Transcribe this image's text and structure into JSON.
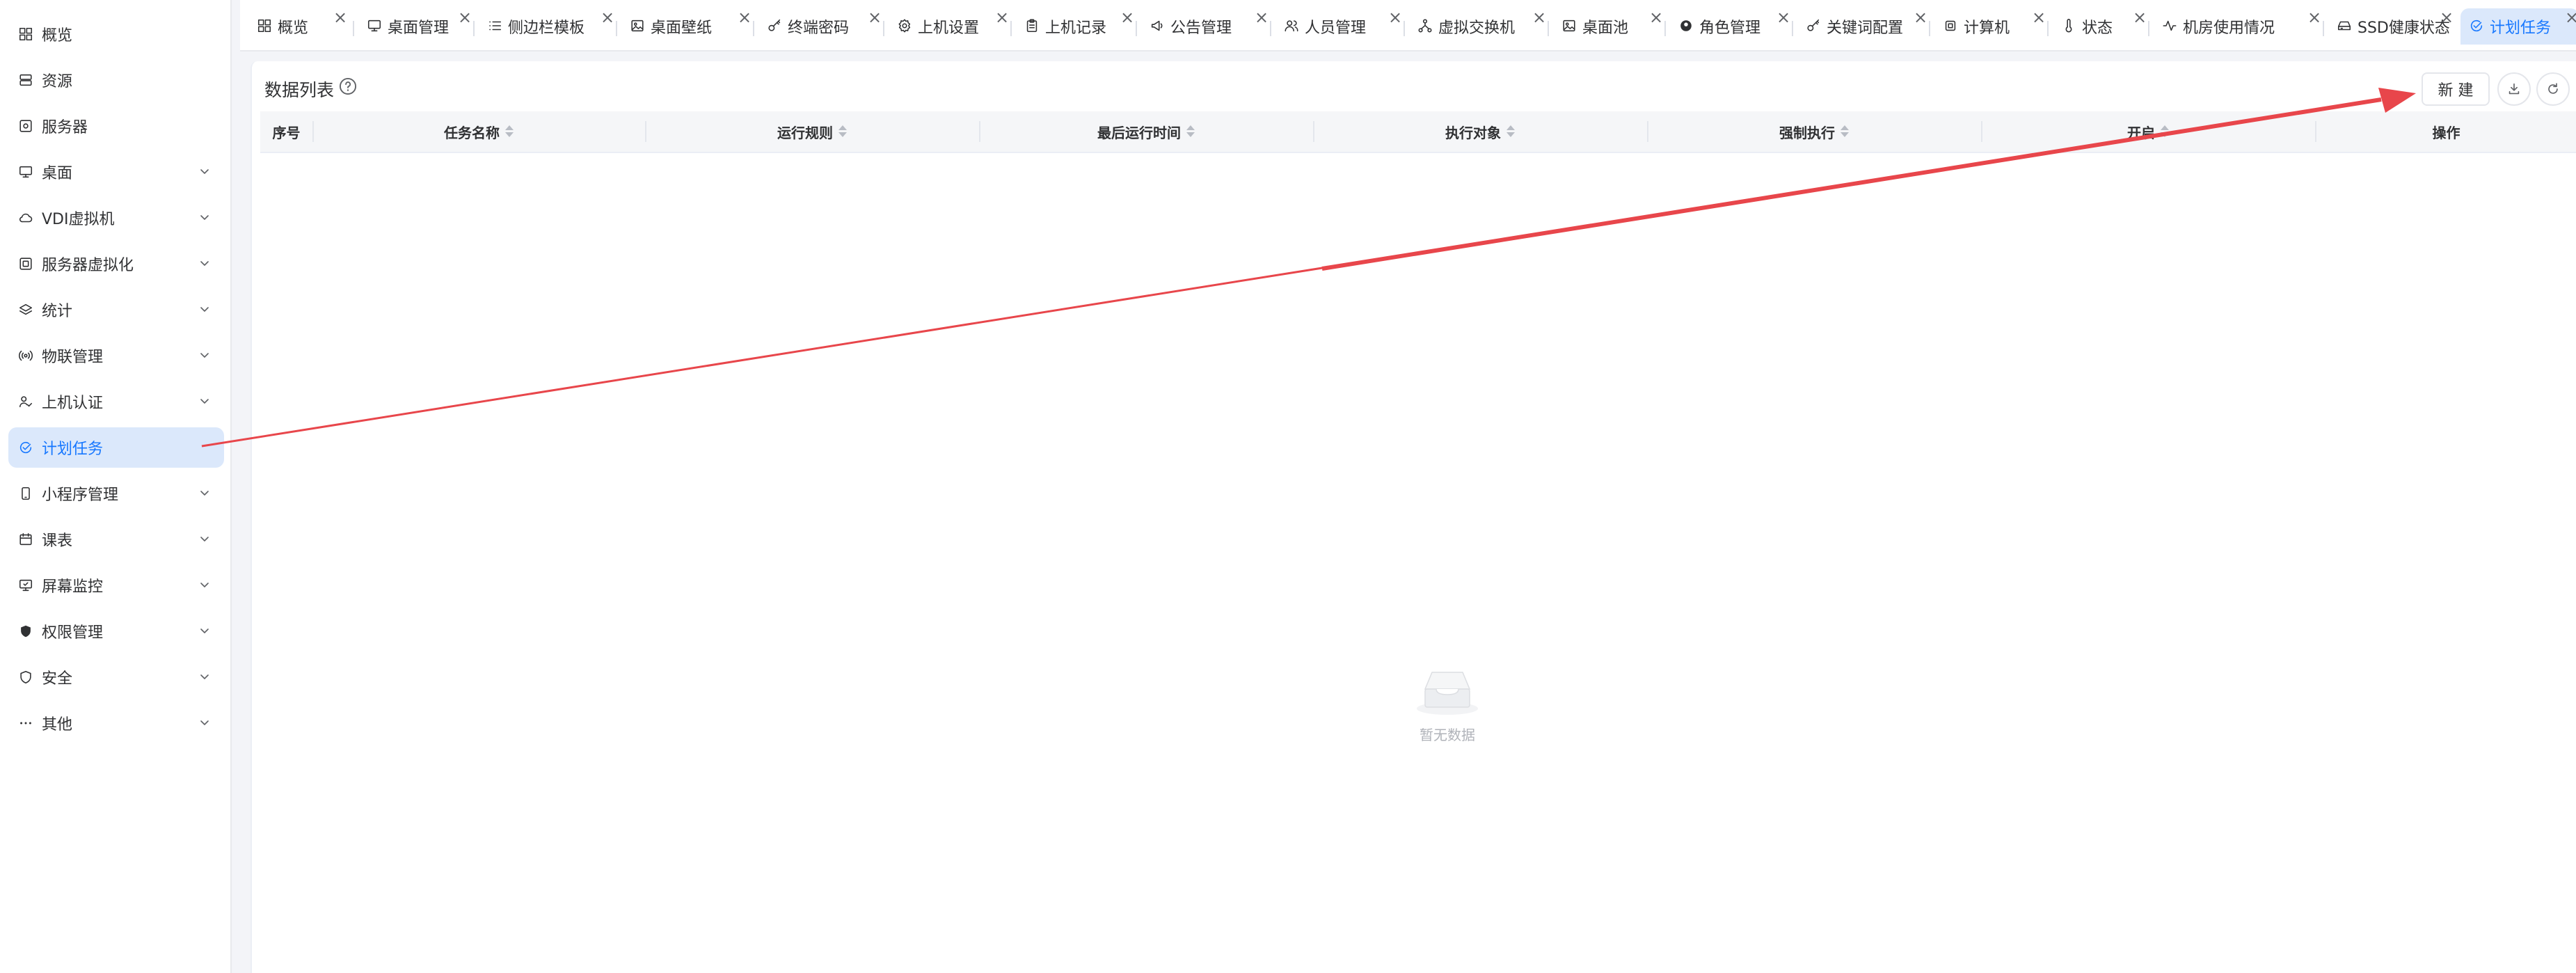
{
  "sidebar": {
    "items": [
      {
        "label": "概览",
        "icon": "grid-icon",
        "has_children": false
      },
      {
        "label": "资源",
        "icon": "server-stack-icon",
        "has_children": false
      },
      {
        "label": "服务器",
        "icon": "server-gear-icon",
        "has_children": false
      },
      {
        "label": "桌面",
        "icon": "monitor-icon",
        "has_children": true
      },
      {
        "label": "VDI虚拟机",
        "icon": "cloud-icon",
        "has_children": true
      },
      {
        "label": "服务器虚拟化",
        "icon": "server-virtual-icon",
        "has_children": true
      },
      {
        "label": "统计",
        "icon": "layers-icon",
        "has_children": true
      },
      {
        "label": "物联管理",
        "icon": "broadcast-icon",
        "has_children": true
      },
      {
        "label": "上机认证",
        "icon": "user-check-icon",
        "has_children": true
      },
      {
        "label": "计划任务",
        "icon": "clock-check-icon",
        "has_children": false,
        "active": true
      },
      {
        "label": "小程序管理",
        "icon": "phone-icon",
        "has_children": true
      },
      {
        "label": "课表",
        "icon": "calendar-icon",
        "has_children": true
      },
      {
        "label": "屏幕监控",
        "icon": "monitor-watch-icon",
        "has_children": true
      },
      {
        "label": "权限管理",
        "icon": "shield-lock-icon",
        "has_children": true
      },
      {
        "label": "安全",
        "icon": "shield-icon",
        "has_children": true
      },
      {
        "label": "其他",
        "icon": "more-icon",
        "has_children": true
      }
    ]
  },
  "tabs": [
    {
      "label": "概览",
      "icon": "grid-icon"
    },
    {
      "label": "桌面管理",
      "icon": "monitor-icon"
    },
    {
      "label": "侧边栏模板",
      "icon": "list-icon"
    },
    {
      "label": "桌面壁纸",
      "icon": "image-icon"
    },
    {
      "label": "终端密码",
      "icon": "key-icon"
    },
    {
      "label": "上机设置",
      "icon": "gear-icon"
    },
    {
      "label": "上机记录",
      "icon": "clipboard-icon"
    },
    {
      "label": "公告管理",
      "icon": "megaphone-icon"
    },
    {
      "label": "人员管理",
      "icon": "users-icon"
    },
    {
      "label": "虚拟交换机",
      "icon": "network-icon"
    },
    {
      "label": "桌面池",
      "icon": "image-icon"
    },
    {
      "label": "角色管理",
      "icon": "role-icon"
    },
    {
      "label": "关键词配置",
      "icon": "key-icon"
    },
    {
      "label": "计算机",
      "icon": "cpu-icon"
    },
    {
      "label": "状态",
      "icon": "thermometer-icon"
    },
    {
      "label": "机房使用情况",
      "icon": "activity-icon"
    },
    {
      "label": "SSD健康状态",
      "icon": "drive-icon"
    },
    {
      "label": "计划任务",
      "icon": "clock-check-icon",
      "active": true
    }
  ],
  "tab_close_glyph": "×",
  "panel": {
    "title": "数据列表",
    "new_button": "新 建",
    "columns": [
      "序号",
      "任务名称",
      "运行规则",
      "最后运行时间",
      "执行对象",
      "强制执行",
      "开启",
      "操作"
    ],
    "sortable": [
      false,
      true,
      true,
      true,
      true,
      true,
      true,
      false
    ],
    "empty_text": "暂无数据"
  },
  "colors": {
    "accent": "#1677ff",
    "active_bg": "#dbe8fb",
    "annotation_arrow": "#e8464b"
  }
}
